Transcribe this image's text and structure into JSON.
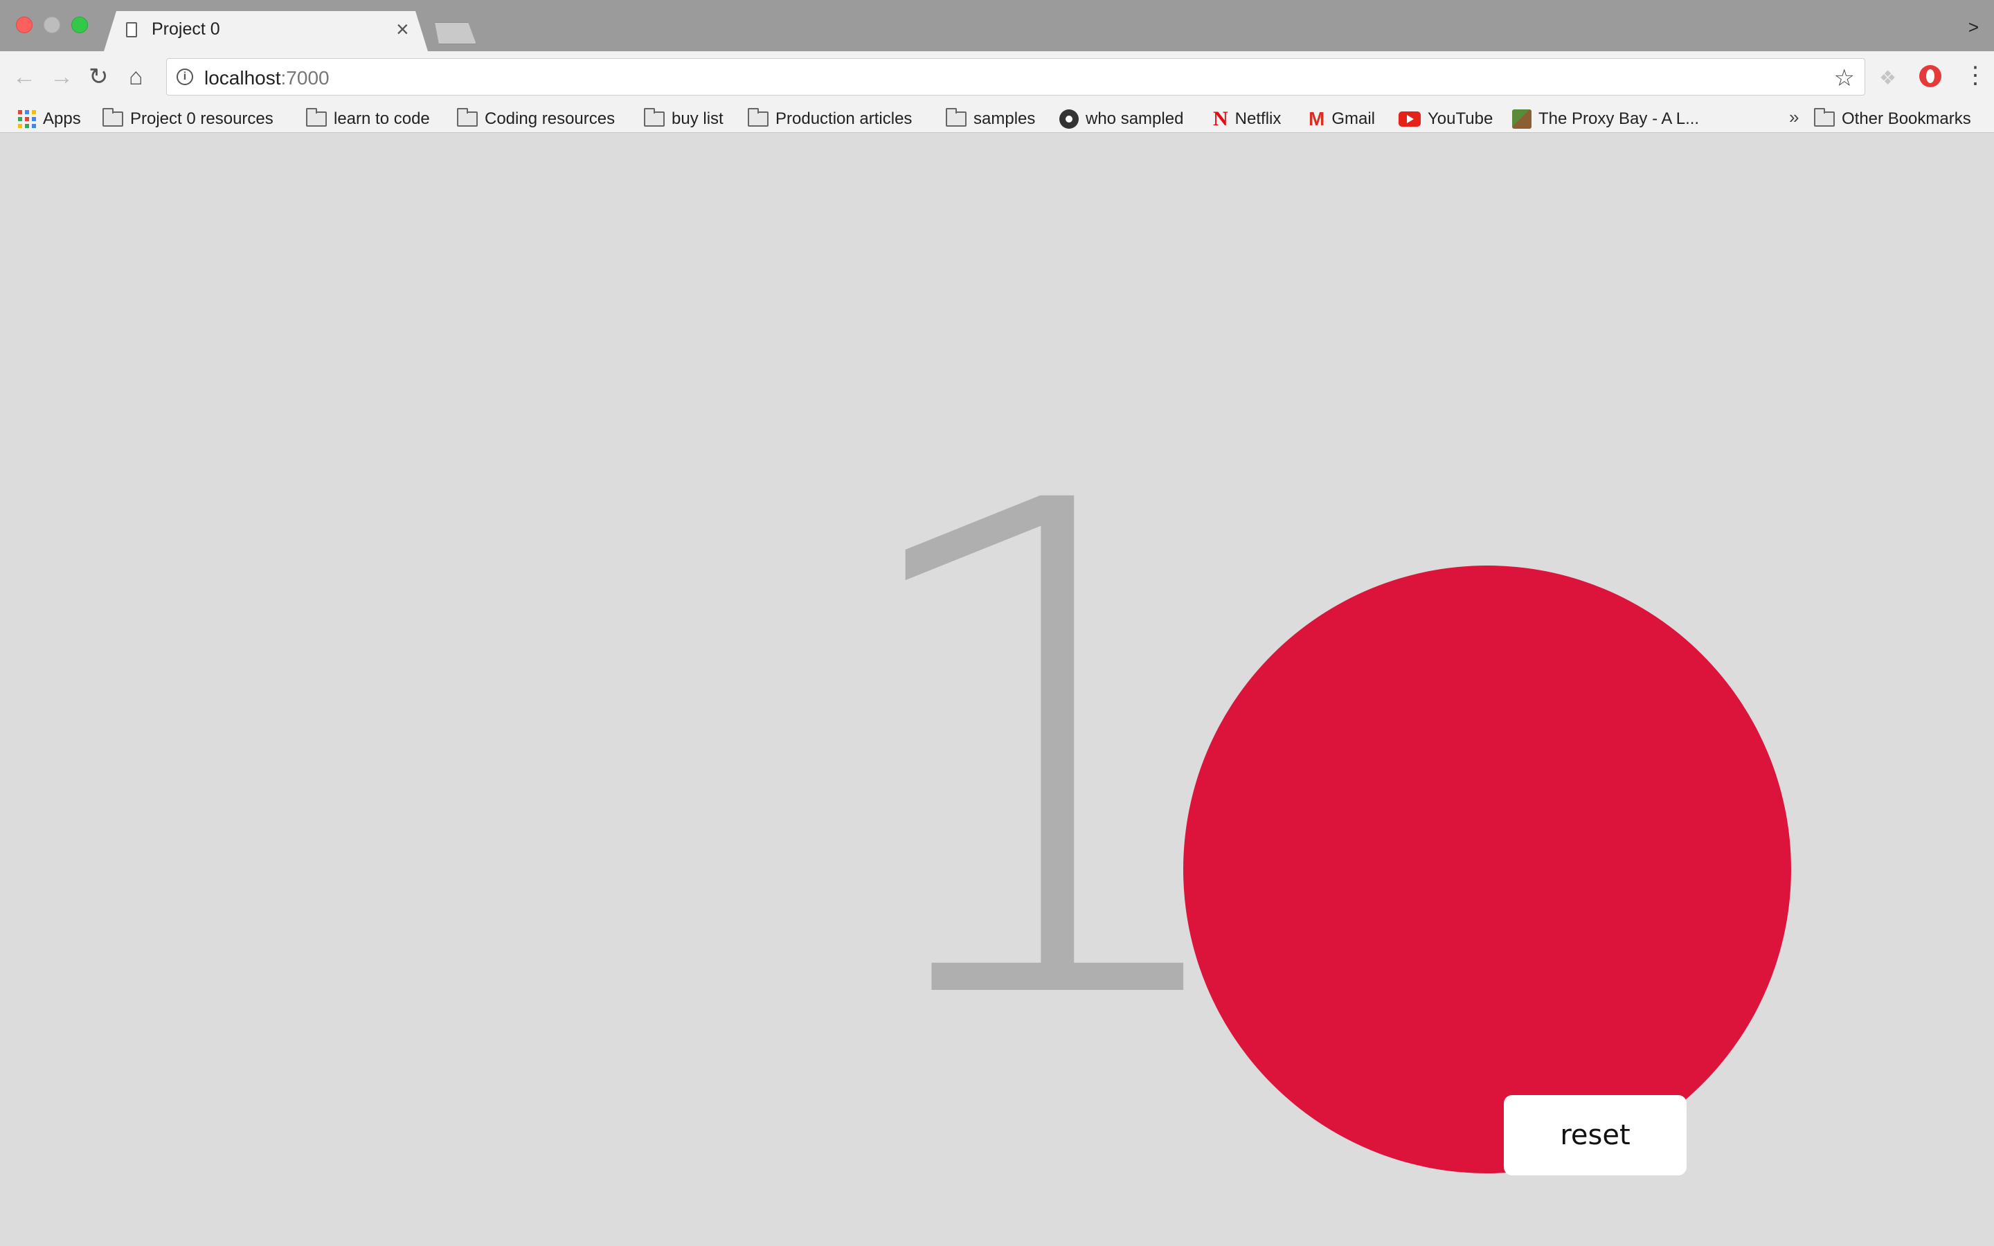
{
  "browser": {
    "tab": {
      "title": "Project 0",
      "close_glyph": "×"
    },
    "tabstrip_chevron": ">",
    "address": {
      "host": "localhost",
      "port": ":7000"
    },
    "icons": {
      "back": "back-arrow-icon",
      "forward": "forward-arrow-icon",
      "reload": "reload-icon",
      "home": "home-icon",
      "info": "info-icon",
      "star": "star-icon",
      "menu": "kebab-menu-icon"
    }
  },
  "bookmarks": {
    "items": [
      {
        "label": "Apps",
        "icon": "apps-grid-icon"
      },
      {
        "label": "Project 0 resources",
        "icon": "folder-icon"
      },
      {
        "label": "learn to code",
        "icon": "folder-icon"
      },
      {
        "label": "Coding resources",
        "icon": "folder-icon"
      },
      {
        "label": "buy list",
        "icon": "folder-icon"
      },
      {
        "label": "Production articles",
        "icon": "folder-icon"
      },
      {
        "label": "samples",
        "icon": "folder-icon"
      },
      {
        "label": "who sampled",
        "icon": "vinyl-icon"
      },
      {
        "label": "Netflix",
        "icon": "netflix-icon"
      },
      {
        "label": "Gmail",
        "icon": "gmail-icon"
      },
      {
        "label": "YouTube",
        "icon": "youtube-icon"
      },
      {
        "label": "The Proxy Bay - A L...",
        "icon": "proxy-bay-icon"
      }
    ],
    "overflow": "»",
    "other": {
      "label": "Other Bookmarks",
      "icon": "folder-icon"
    }
  },
  "page": {
    "counter": "1",
    "reset_label": "reset",
    "colors": {
      "background": "#dcdcdc",
      "counter": "#afafaf",
      "circle": "#dc143c",
      "button": "#ffffff"
    }
  }
}
